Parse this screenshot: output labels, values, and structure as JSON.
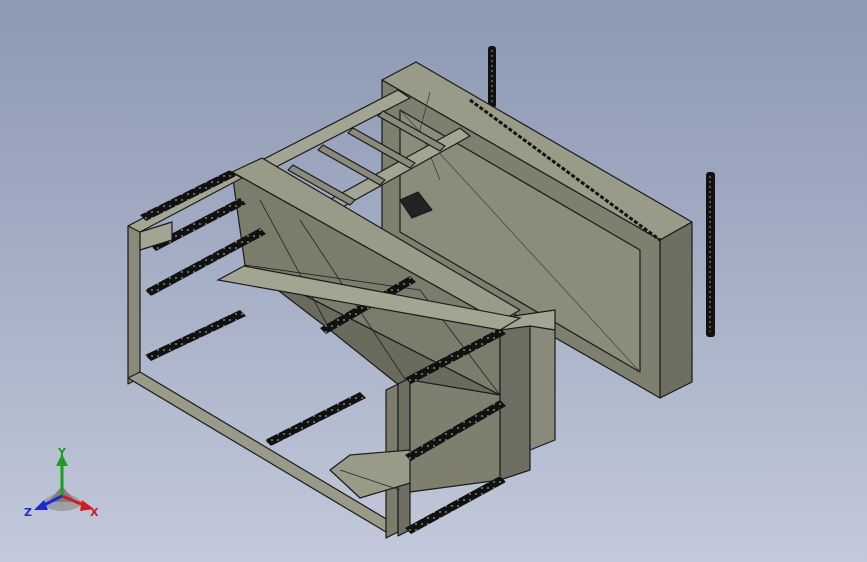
{
  "viewport": {
    "background_top": "#8d98b3",
    "background_bottom": "#c2c9da",
    "model_face_color": "#8a8a7a",
    "model_edge_color": "#1a1a1a"
  },
  "triad": {
    "x_label": "X",
    "y_label": "Y",
    "z_label": "Z",
    "x_color": "#d61a1a",
    "y_color": "#1aa01a",
    "z_color": "#1a2ad6"
  }
}
